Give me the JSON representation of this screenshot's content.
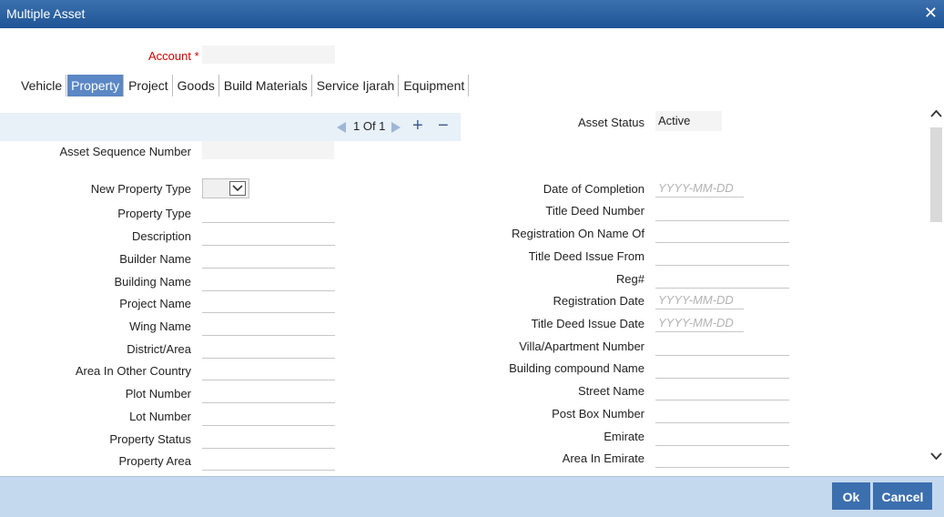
{
  "window": {
    "title": "Multiple Asset",
    "close_glyph": "✕"
  },
  "account": {
    "label": "Account",
    "required_mark": "*",
    "value": ""
  },
  "tabs": [
    {
      "label": "Vehicle"
    },
    {
      "label": "Property"
    },
    {
      "label": "Project"
    },
    {
      "label": "Goods"
    },
    {
      "label": "Build Materials"
    },
    {
      "label": "Service Ijarah"
    },
    {
      "label": "Equipment"
    }
  ],
  "active_tab": "Property",
  "pager": {
    "text": "1 Of 1",
    "prev_icon": "triangle-left-icon",
    "next_icon": "triangle-right-icon",
    "add": "+",
    "remove": "−"
  },
  "asset_status": {
    "label": "Asset Status",
    "value": "Active"
  },
  "left_fields": {
    "asset_sequence_number": "Asset Sequence Number",
    "new_property_type": "New Property Type",
    "property_type": "Property Type",
    "description": "Description",
    "builder_name": "Builder Name",
    "building_name": "Building Name",
    "project_name": "Project Name",
    "wing_name": "Wing Name",
    "district_area": "District/Area",
    "area_in_other_country": "Area In Other Country",
    "plot_number": "Plot Number",
    "lot_number": "Lot Number",
    "property_status": "Property Status",
    "property_area": "Property Area"
  },
  "right_fields": {
    "date_of_completion": "Date of Completion",
    "title_deed_number": "Title Deed Number",
    "registration_on_name_of": "Registration On Name Of",
    "title_deed_issue_from": "Title Deed Issue From",
    "reg_no": "Reg#",
    "registration_date": "Registration Date",
    "title_deed_issue_date": "Title Deed Issue Date",
    "villa_apartment_number": "Villa/Apartment Number",
    "building_compound_name": "Building compound Name",
    "street_name": "Street Name",
    "post_box_number": "Post Box Number",
    "emirate": "Emirate",
    "area_in_emirate": "Area In Emirate"
  },
  "date_placeholder": "YYYY-MM-DD",
  "buttons": {
    "ok": "Ok",
    "cancel": "Cancel"
  }
}
